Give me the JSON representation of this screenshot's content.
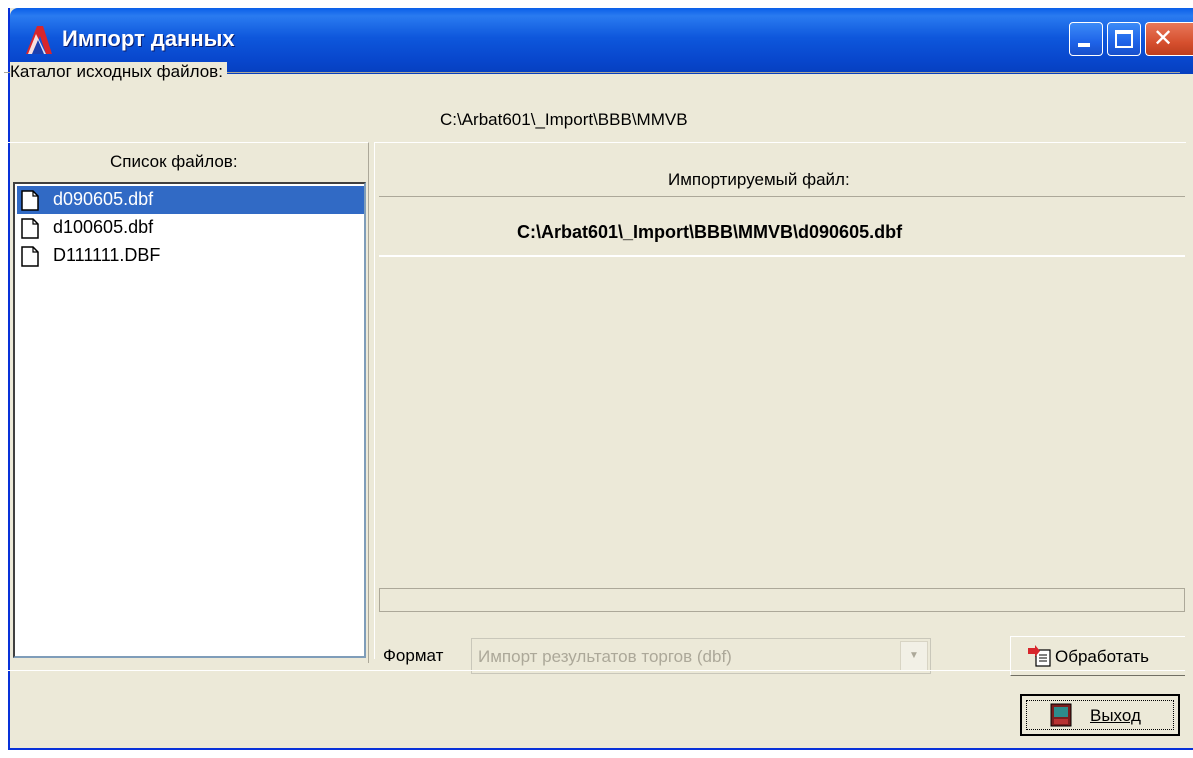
{
  "window": {
    "title": "Импорт данных"
  },
  "source_dir": {
    "label": "Каталог исходных файлов:",
    "path": "C:\\Arbat601\\_Import\\BBB\\MMVB"
  },
  "file_list": {
    "caption": "Список файлов:",
    "items": [
      {
        "name": "d090605.dbf",
        "selected": true
      },
      {
        "name": "d100605.dbf",
        "selected": false
      },
      {
        "name": "D111111.DBF",
        "selected": false
      }
    ]
  },
  "import_file": {
    "caption": "Импортируемый файл:",
    "path": "C:\\Arbat601\\_Import\\BBB\\MMVB\\d090605.dbf"
  },
  "format": {
    "label": "Формат",
    "value": "Импорт результатов торгов (dbf)"
  },
  "buttons": {
    "process": "Обработать",
    "exit": "Выход"
  },
  "colors": {
    "titlebar": "#0E57DC",
    "selection": "#316AC5",
    "face": "#ECE9D8"
  }
}
